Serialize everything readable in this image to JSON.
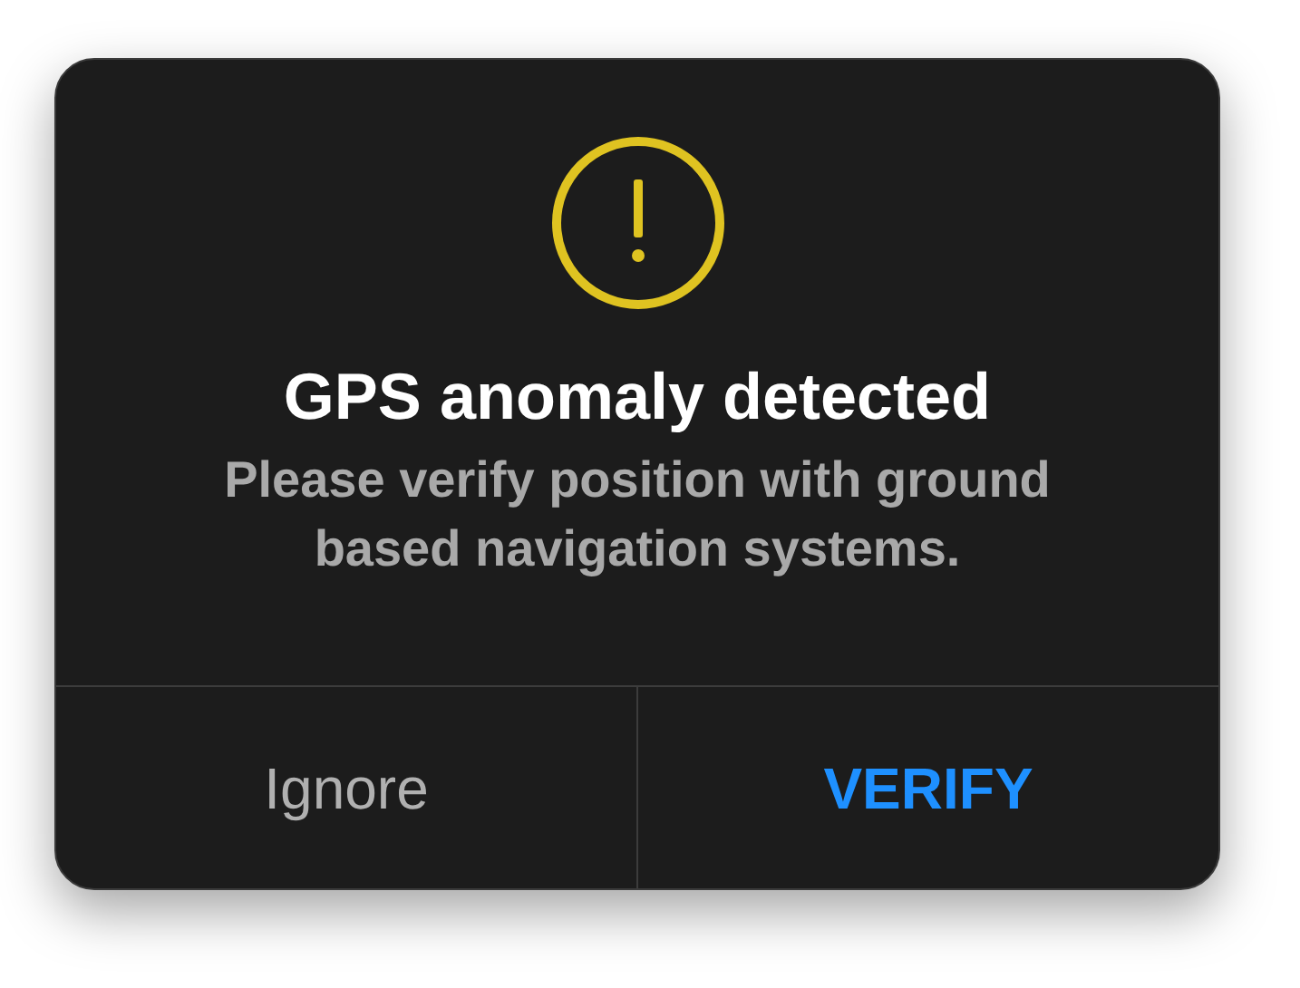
{
  "dialog": {
    "title": "GPS anomaly detected",
    "message": "Please verify position with ground based navigation systems.",
    "buttons": [
      {
        "label": "Ignore",
        "kind": "secondary"
      },
      {
        "label": "VERIFY",
        "kind": "primary"
      }
    ]
  }
}
